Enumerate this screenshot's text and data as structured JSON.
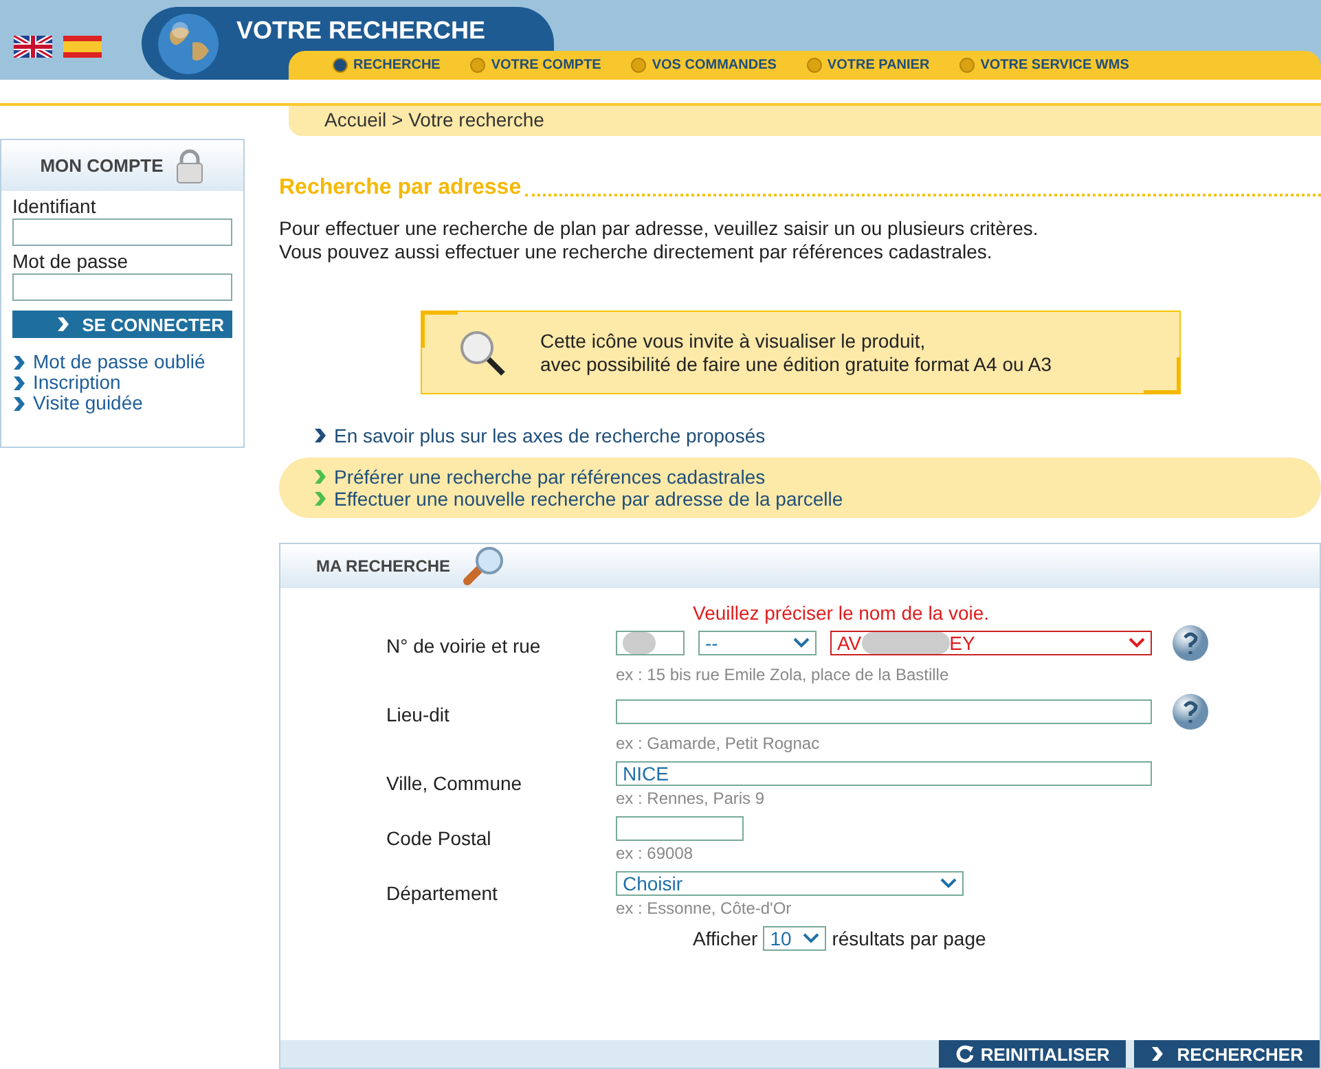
{
  "header": {
    "title": "VOTRE RECHERCHE",
    "languages": [
      {
        "kind": "uk"
      },
      {
        "kind": "es"
      }
    ],
    "nav": [
      {
        "label": "RECHERCHE",
        "selected": true
      },
      {
        "label": "VOTRE COMPTE",
        "selected": false
      },
      {
        "label": "VOS COMMANDES",
        "selected": false
      },
      {
        "label": "VOTRE PANIER",
        "selected": false
      },
      {
        "label": "VOTRE SERVICE WMS",
        "selected": false
      }
    ]
  },
  "breadcrumb": "Accueil > Votre recherche",
  "sidebar": {
    "title": "MON COMPTE",
    "fields": [
      {
        "label": "Identifiant"
      },
      {
        "label": "Mot de passe"
      }
    ],
    "button": "SE CONNECTER",
    "links": [
      "Mot de passe oublié",
      "Inscription",
      "Visite guidée"
    ]
  },
  "heading": "Recherche par adresse",
  "intro": [
    "Pour effectuer une recherche de plan par adresse, veuillez saisir un ou plusieurs critères.",
    "Vous pouvez aussi effectuer une recherche directement par références cadastrales."
  ],
  "info_box": [
    "Cette icône vous invite à visualiser le produit,",
    "avec possibilité de faire une édition gratuite format A4 ou A3"
  ],
  "more_link": "En savoir plus sur les axes de recherche proposés",
  "alt_links": [
    "Préférer une recherche par références cadastrales",
    "Effectuer une nouvelle recherche par adresse de la parcelle"
  ],
  "form": {
    "title": "MA RECHERCHE",
    "error": "Veuillez préciser le nom de la voie.",
    "rows": [
      {
        "kind": "street",
        "label": "N° de voirie et rue",
        "type_value": "--",
        "street_start": "AV",
        "street_end": "EY",
        "hint": "ex : 15 bis rue Emile Zola, place de la Bastille",
        "help": true
      },
      {
        "kind": "text",
        "label": "Lieu-dit",
        "value": "",
        "hint": "ex : Gamarde, Petit Rognac",
        "help": true
      },
      {
        "kind": "text",
        "label": "Ville, Commune",
        "value": "NICE",
        "hint": "ex : Rennes, Paris 9",
        "help": false
      },
      {
        "kind": "short",
        "label": "Code Postal",
        "value": "",
        "hint": "ex : 69008",
        "help": false
      },
      {
        "kind": "select",
        "label": "Département",
        "value": "Choisir",
        "hint": "ex : Essonne, Côte-d'Or",
        "help": false
      }
    ],
    "per_page": {
      "before": "Afficher",
      "value": "10",
      "after": "résultats par page"
    },
    "buttons": [
      {
        "kind": "reset",
        "label": "REINITIALISER"
      },
      {
        "kind": "search",
        "label": "RECHERCHER"
      }
    ]
  }
}
